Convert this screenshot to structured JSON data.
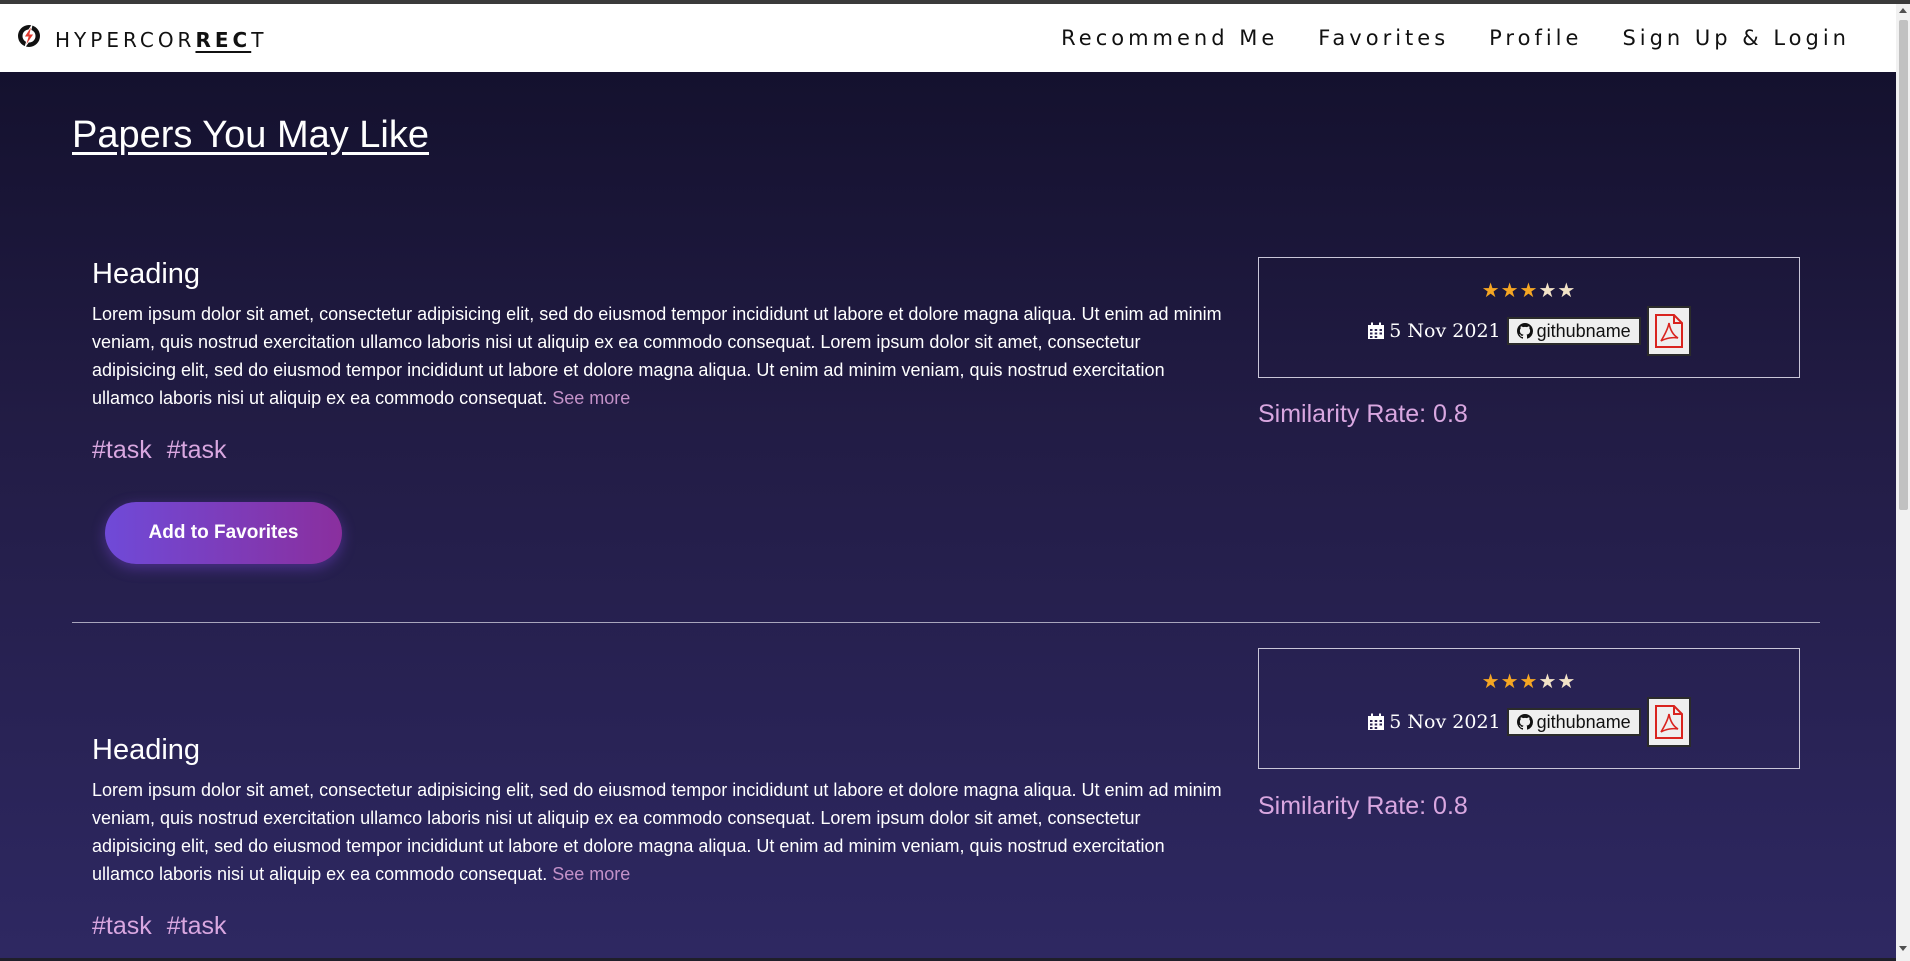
{
  "navbar": {
    "brand_prefix": "HYPERCOR",
    "brand_bold": "REC",
    "brand_suffix": "T",
    "links": [
      "Recommend Me",
      "Favorites",
      "Profile",
      "Sign Up & Login"
    ]
  },
  "page": {
    "title": "Papers You May Like"
  },
  "papers": [
    {
      "heading": "Heading",
      "abstract": "Lorem ipsum dolor sit amet, consectetur adipisicing elit, sed do eiusmod tempor incididunt ut labore et dolore magna aliqua. Ut enim ad minim veniam, quis nostrud exercitation ullamco laboris nisi ut aliquip ex ea commodo consequat. Lorem ipsum dolor sit amet, consectetur adipisicing elit, sed do eiusmod tempor incididunt ut labore et dolore magna aliqua. Ut enim ad minim veniam, quis nostrud exercitation ullamco laboris nisi ut aliquip ex ea commodo consequat.",
      "see_more": "See more",
      "tags": [
        "#task",
        "#task"
      ],
      "favorite_label": "Add to Favorites",
      "rating": 3,
      "rating_max": 5,
      "date": "5 Nov 2021",
      "github": "githubname",
      "similarity": "Similarity Rate: 0.8"
    },
    {
      "heading": "Heading",
      "abstract": "Lorem ipsum dolor sit amet, consectetur adipisicing elit, sed do eiusmod tempor incididunt ut labore et dolore magna aliqua. Ut enim ad minim veniam, quis nostrud exercitation ullamco laboris nisi ut aliquip ex ea commodo consequat. Lorem ipsum dolor sit amet, consectetur adipisicing elit, sed do eiusmod tempor incididunt ut labore et dolore magna aliqua. Ut enim ad minim veniam, quis nostrud exercitation ullamco laboris nisi ut aliquip ex ea commodo consequat.",
      "see_more": "See more",
      "tags": [
        "#task",
        "#task"
      ],
      "rating": 3,
      "rating_max": 5,
      "date": "5 Nov 2021",
      "github": "githubname",
      "similarity": "Similarity Rate: 0.8"
    }
  ],
  "colors": {
    "accent_pink": "#d9a7e0",
    "star_filled": "#f5a623",
    "star_empty": "#f2e3c8",
    "pdf_red": "#d9241f"
  }
}
